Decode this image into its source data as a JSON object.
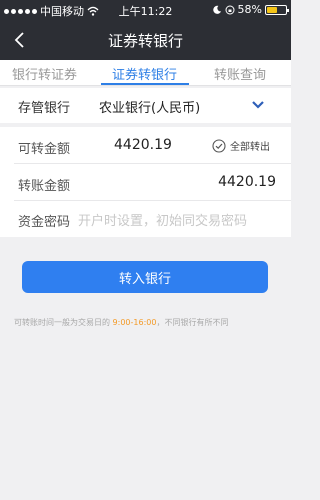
{
  "status_bar": {
    "carrier": "中国移动",
    "time": "上午11:22",
    "battery": "58%",
    "battery_level": 0.58
  },
  "nav": {
    "title": "证券转银行"
  },
  "tabs": [
    {
      "label": "银行转证券",
      "active": false
    },
    {
      "label": "证券转银行",
      "active": true
    },
    {
      "label": "转账查询",
      "active": false
    }
  ],
  "bank": {
    "label": "存管银行",
    "value": "农业银行(人民币)"
  },
  "transferable": {
    "label": "可转金额",
    "value": "4420.19",
    "all_out_label": "全部转出"
  },
  "amount": {
    "label": "转账金额",
    "value": "4420.19"
  },
  "password": {
    "label": "资金密码",
    "placeholder": "开户时设置，初始同交易密码"
  },
  "submit_label": "转入银行",
  "notice": {
    "prefix": "可转账时间一般为交易日的 ",
    "hours": "9:00-16:00",
    "suffix": "，不同银行有所不同"
  },
  "colors": {
    "accent": "#2e7fe6",
    "header_bg": "#2c2e34",
    "highlight": "#f39b2a"
  }
}
